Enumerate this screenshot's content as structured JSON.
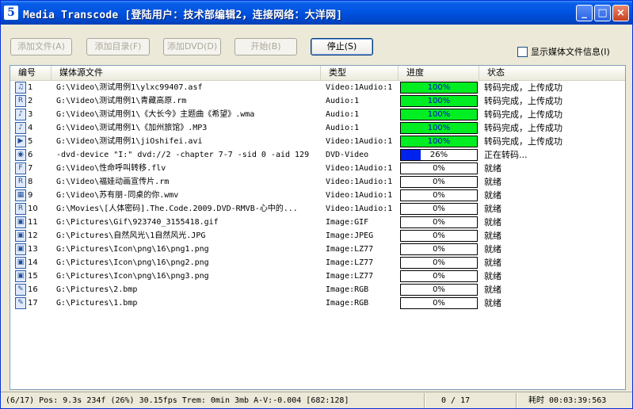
{
  "window": {
    "title": "Media Transcode  [登陆用户：技术部编辑2，连接网络：大洋网]",
    "app_icon": "5",
    "minimize_label": "_",
    "maximize_label": "□",
    "close_label": "×"
  },
  "toolbar": {
    "add_file_label": "添加文件(A)",
    "add_dir_label": "添加目录(F)",
    "add_dvd_label": "添加DVD(D)",
    "start_label": "开始(B)",
    "stop_label": "停止(S)",
    "show_info_label": "显示媒体文件信息(I)",
    "show_info_checked": false
  },
  "columns": {
    "num": "编号",
    "file": "媒体源文件",
    "type": "类型",
    "progress": "进度",
    "status": "状态"
  },
  "colors": {
    "done": "#00ee22",
    "active": "#0022ee"
  },
  "rows": [
    {
      "num": "1",
      "file": "G:\\Video\\测试用例1\\ylxc99407.asf",
      "type": "Video:1Audio:1",
      "progress": "100%",
      "fraction": 1.0,
      "state": "done",
      "status": "转码完成，上传成功",
      "icon": "asf-file-icon",
      "glyph": "♫"
    },
    {
      "num": "2",
      "file": "G:\\Video\\测试用例1\\青藏高原.rm",
      "type": "Audio:1",
      "progress": "100%",
      "fraction": 1.0,
      "state": "done",
      "status": "转码完成，上传成功",
      "icon": "realmedia-file-icon",
      "glyph": "R"
    },
    {
      "num": "3",
      "file": "G:\\Video\\测试用例1\\《大长今》主题曲《希望》.wma",
      "type": "Audio:1",
      "progress": "100%",
      "fraction": 1.0,
      "state": "done",
      "status": "转码完成，上传成功",
      "icon": "wma-file-icon",
      "glyph": "♪"
    },
    {
      "num": "4",
      "file": "G:\\Video\\测试用例1\\《加州旅馆》.MP3",
      "type": "Audio:1",
      "progress": "100%",
      "fraction": 1.0,
      "state": "done",
      "status": "转码完成，上传成功",
      "icon": "mp3-file-icon",
      "glyph": "♪"
    },
    {
      "num": "5",
      "file": "G:\\Video\\测试用例1\\jiOshifei.avi",
      "type": "Video:1Audio:1",
      "progress": "100%",
      "fraction": 1.0,
      "state": "done",
      "status": "转码完成，上传成功",
      "icon": "avi-file-icon",
      "glyph": "▶"
    },
    {
      "num": "6",
      "file": "-dvd-device \"I:\" dvd://2 -chapter 7-7 -sid 0 -aid 129",
      "type": "DVD-Video",
      "progress": "26%",
      "fraction": 0.26,
      "state": "active",
      "status": "正在转码...",
      "icon": "dvd-disc-icon",
      "glyph": "◉"
    },
    {
      "num": "7",
      "file": "G:\\Video\\性命呼叫转移.flv",
      "type": "Video:1Audio:1",
      "progress": "0%",
      "fraction": 0,
      "state": "pending",
      "status": "就绪",
      "icon": "flv-file-icon",
      "glyph": "F"
    },
    {
      "num": "8",
      "file": "G:\\Video\\福娃动画宣传片.rm",
      "type": "Video:1Audio:1",
      "progress": "0%",
      "fraction": 0,
      "state": "pending",
      "status": "就绪",
      "icon": "realmedia-file-icon",
      "glyph": "R"
    },
    {
      "num": "9",
      "file": "G:\\Video\\苏有朋-同桌的你.wmv",
      "type": "Video:1Audio:1",
      "progress": "0%",
      "fraction": 0,
      "state": "pending",
      "status": "就绪",
      "icon": "wmv-file-icon",
      "glyph": "▦"
    },
    {
      "num": "10",
      "file": "G:\\Movies\\[人体密码].The.Code.2009.DVD-RMVB-心中的...",
      "type": "Video:1Audio:1",
      "progress": "0%",
      "fraction": 0,
      "state": "pending",
      "status": "就绪",
      "icon": "rmvb-file-icon",
      "glyph": "R"
    },
    {
      "num": "11",
      "file": "G:\\Pictures\\Gif\\923740_3155418.gif",
      "type": "Image:GIF",
      "progress": "0%",
      "fraction": 0,
      "state": "pending",
      "status": "就绪",
      "icon": "gif-image-icon",
      "glyph": "▣"
    },
    {
      "num": "12",
      "file": "G:\\Pictures\\自然风光\\1自然风光.JPG",
      "type": "Image:JPEG",
      "progress": "0%",
      "fraction": 0,
      "state": "pending",
      "status": "就绪",
      "icon": "jpeg-image-icon",
      "glyph": "▣"
    },
    {
      "num": "13",
      "file": "G:\\Pictures\\Icon\\png\\16\\png1.png",
      "type": "Image:LZ77",
      "progress": "0%",
      "fraction": 0,
      "state": "pending",
      "status": "就绪",
      "icon": "png-image-icon",
      "glyph": "▣"
    },
    {
      "num": "14",
      "file": "G:\\Pictures\\Icon\\png\\16\\png2.png",
      "type": "Image:LZ77",
      "progress": "0%",
      "fraction": 0,
      "state": "pending",
      "status": "就绪",
      "icon": "png-image-icon",
      "glyph": "▣"
    },
    {
      "num": "15",
      "file": "G:\\Pictures\\Icon\\png\\16\\png3.png",
      "type": "Image:LZ77",
      "progress": "0%",
      "fraction": 0,
      "state": "pending",
      "status": "就绪",
      "icon": "png-image-icon",
      "glyph": "▣"
    },
    {
      "num": "16",
      "file": "G:\\Pictures\\2.bmp",
      "type": "Image:RGB",
      "progress": "0%",
      "fraction": 0,
      "state": "pending",
      "status": "就绪",
      "icon": "bmp-image-icon",
      "glyph": "✎"
    },
    {
      "num": "17",
      "file": "G:\\Pictures\\1.bmp",
      "type": "Image:RGB",
      "progress": "0%",
      "fraction": 0,
      "state": "pending",
      "status": "就绪",
      "icon": "bmp-image-icon",
      "glyph": "✎"
    }
  ],
  "statusbar": {
    "playback": "(6/17)  Pos:   9.3s    234f (26%) 30.15fps Trem:    0min    3mb  A-V:-0.004 [682:128]",
    "count": "0 / 17",
    "elapsed": "耗时 00:03:39:563"
  }
}
